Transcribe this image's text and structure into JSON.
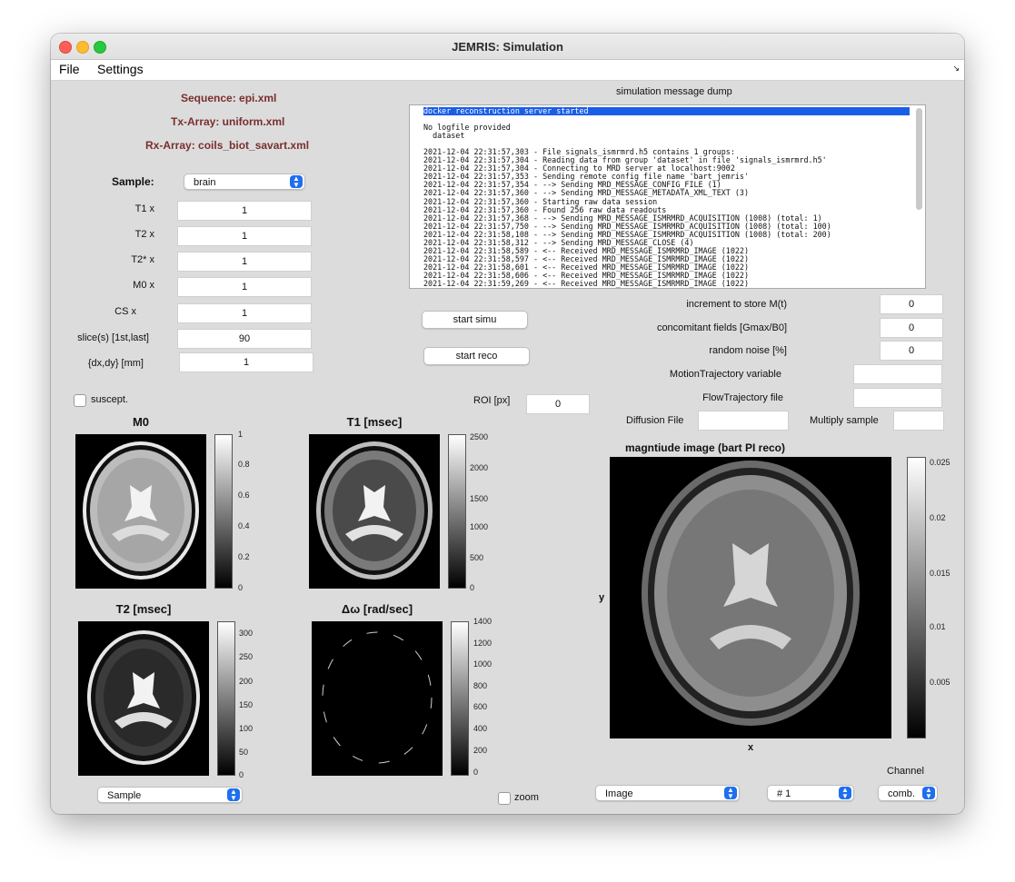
{
  "window": {
    "title": "JEMRIS: Simulation"
  },
  "menu": {
    "file": "File",
    "settings": "Settings",
    "corner_icon": "resize-corner-icon"
  },
  "sequence": {
    "sequence": "Sequence: epi.xml",
    "tx": "Tx-Array: uniform.xml",
    "rx": "Rx-Array: coils_biot_savart.xml"
  },
  "sample": {
    "label": "Sample:",
    "selected": "brain",
    "fields": [
      {
        "label": "T1 x",
        "value": "1"
      },
      {
        "label": "T2 x",
        "value": "1"
      },
      {
        "label": "T2* x",
        "value": "1"
      },
      {
        "label": "M0 x",
        "value": "1"
      },
      {
        "label": "CS x",
        "value": "1"
      },
      {
        "label": "slice(s) [1st,last]",
        "value": "90"
      },
      {
        "label": "{dx,dy} [mm]",
        "value": "1"
      }
    ],
    "suscept_label": "suscept."
  },
  "dump": {
    "title": "simulation message dump",
    "lines": [
      "docker reconstruction server started",
      "",
      "No logfile provided",
      "  dataset",
      "",
      "2021-12-04 22:31:57,303 - File signals_ismrmrd.h5 contains 1 groups:",
      "2021-12-04 22:31:57,304 - Reading data from group 'dataset' in file 'signals_ismrmrd.h5'",
      "2021-12-04 22:31:57,304 - Connecting to MRD server at localhost:9002",
      "2021-12-04 22:31:57,353 - Sending remote config file name 'bart_jemris'",
      "2021-12-04 22:31:57,354 - --> Sending MRD_MESSAGE_CONFIG_FILE (1)",
      "2021-12-04 22:31:57,360 - --> Sending MRD_MESSAGE_METADATA_XML_TEXT (3)",
      "2021-12-04 22:31:57,360 - Starting raw data session",
      "2021-12-04 22:31:57,360 - Found 256 raw data readouts",
      "2021-12-04 22:31:57,368 - --> Sending MRD_MESSAGE_ISMRMRD_ACQUISITION (1008) (total: 1)",
      "2021-12-04 22:31:57,750 - --> Sending MRD_MESSAGE_ISMRMRD_ACQUISITION (1008) (total: 100)",
      "2021-12-04 22:31:58,108 - --> Sending MRD_MESSAGE_ISMRMRD_ACQUISITION (1008) (total: 200)",
      "2021-12-04 22:31:58,312 - --> Sending MRD_MESSAGE_CLOSE (4)",
      "2021-12-04 22:31:58,589 - <-- Received MRD_MESSAGE_ISMRMRD_IMAGE (1022)",
      "2021-12-04 22:31:58,597 - <-- Received MRD_MESSAGE_ISMRMRD_IMAGE (1022)",
      "2021-12-04 22:31:58,601 - <-- Received MRD_MESSAGE_ISMRMRD_IMAGE (1022)",
      "2021-12-04 22:31:58,606 - <-- Received MRD_MESSAGE_ISMRMRD_IMAGE (1022)",
      "2021-12-04 22:31:59,269 - <-- Received MRD_MESSAGE_ISMRMRD_IMAGE (1022)"
    ]
  },
  "buttons": {
    "start_simu": "start simu",
    "start_reco": "start reco"
  },
  "params": {
    "increment_label": "increment to store M(t)",
    "increment": "0",
    "concomitant_label": "concomitant fields [Gmax/B0]",
    "concomitant": "0",
    "noise_label": "random noise [%]",
    "noise": "0",
    "motion_label": "MotionTrajectory variable",
    "motion": "",
    "flow_label": "FlowTrajectory file",
    "flow": "",
    "diffusion_label": "Diffusion File",
    "diffusion": "",
    "multiply_label": "Multiply sample",
    "multiply": "",
    "roi_label": "ROI [px]",
    "roi": "0"
  },
  "plots": {
    "m0": {
      "title": "M0",
      "ticks": [
        "1",
        "0.8",
        "0.6",
        "0.4",
        "0.2",
        "0"
      ]
    },
    "t1": {
      "title": "T1 [msec]",
      "ticks": [
        "2500",
        "2000",
        "1500",
        "1000",
        "500",
        "0"
      ]
    },
    "t2": {
      "title": "T2 [msec]",
      "ticks": [
        "300",
        "250",
        "200",
        "150",
        "100",
        "50",
        "0"
      ]
    },
    "dw": {
      "title": "Δω [rad/sec]",
      "ticks": [
        "1400",
        "1200",
        "1000",
        "800",
        "600",
        "400",
        "200",
        "0"
      ]
    },
    "recon": {
      "title": "magntiude image  (bart PI reco)",
      "xlabel": "x",
      "ylabel": "y",
      "ticks": [
        "0.025",
        "0.02",
        "0.015",
        "0.01",
        "0.005"
      ]
    }
  },
  "bottom": {
    "sample_select": "Sample",
    "zoom_label": "zoom",
    "image_select": "Image",
    "coil_select": "# 1",
    "channel_label": "Channel",
    "channel_select": "comb."
  },
  "colors": {
    "close": "#fe5f57",
    "minimize": "#febc2e",
    "maximize": "#28c840",
    "accent": "#1e6ff0",
    "sequence_text": "#7a2e2e"
  }
}
